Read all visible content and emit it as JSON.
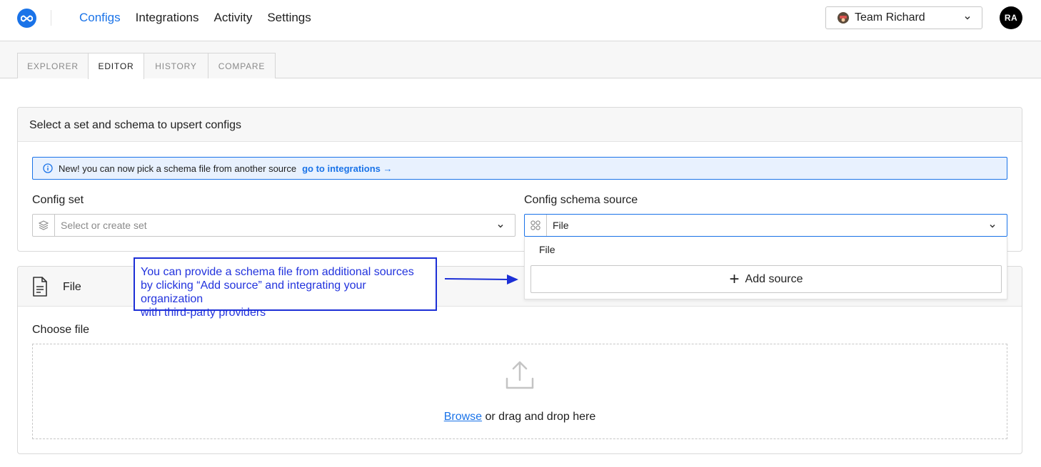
{
  "nav": {
    "items": [
      {
        "label": "Configs",
        "active": true
      },
      {
        "label": "Integrations",
        "active": false
      },
      {
        "label": "Activity",
        "active": false
      },
      {
        "label": "Settings",
        "active": false
      }
    ],
    "team": "Team Richard",
    "avatar": "RA"
  },
  "tabs": [
    {
      "label": "EXPLORER",
      "active": false
    },
    {
      "label": "EDITOR",
      "active": true
    },
    {
      "label": "HISTORY",
      "active": false
    },
    {
      "label": "COMPARE",
      "active": false
    }
  ],
  "selectCard": {
    "title": "Select a set and schema to upsert configs",
    "banner": {
      "message": "New! you can now pick a schema file from another source",
      "link": "go to integrations →"
    },
    "configSet": {
      "label": "Config set",
      "placeholder": "Select or create set"
    },
    "schemaSource": {
      "label": "Config schema source",
      "value": "File"
    },
    "dropdown": {
      "option": "File",
      "add": "Add source"
    }
  },
  "fileCard": {
    "title": "File",
    "chooseLabel": "Choose file",
    "browse": "Browse",
    "dropText": " or drag and drop here"
  },
  "annotation": {
    "lines": [
      "You can provide a schema file from additional sources",
      "by clicking “Add source” and integrating your organization",
      "with third-party providers"
    ]
  },
  "colors": {
    "accent": "#1a73e8",
    "annotation": "#2233dd"
  }
}
